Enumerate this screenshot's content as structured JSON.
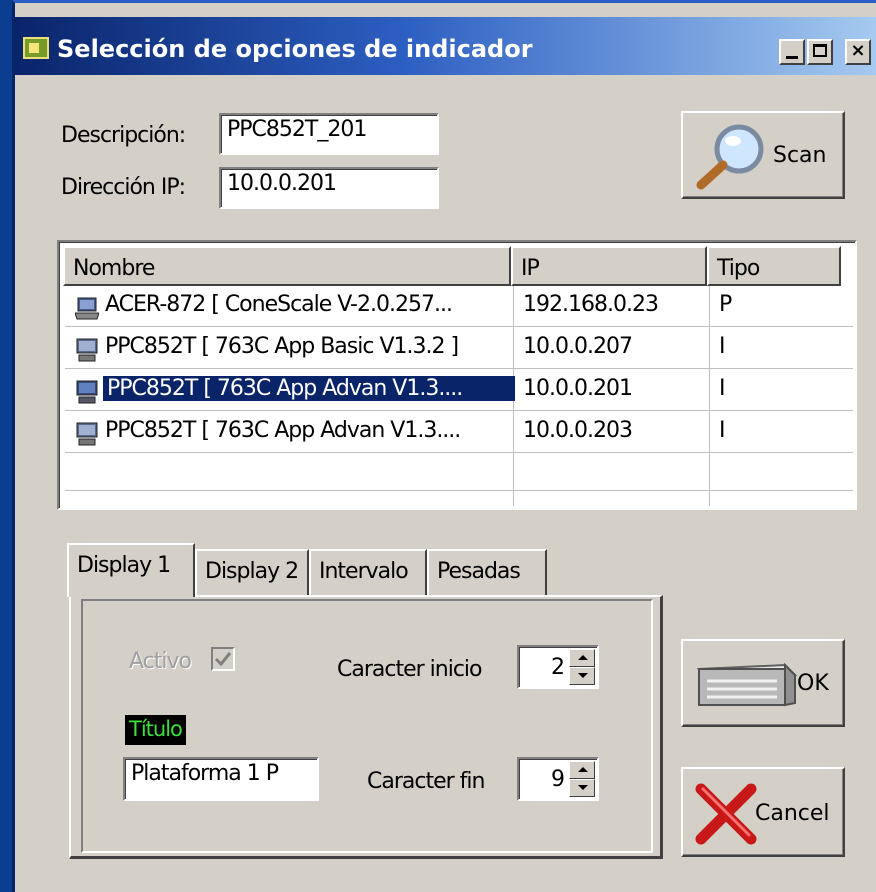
{
  "window": {
    "title": "Selección de opciones de indicador",
    "controls": {
      "minimize": "_",
      "maximize": "□",
      "close": "×"
    }
  },
  "form": {
    "descripcion_label": "Descripción:",
    "descripcion_value": "PPC852T_201",
    "ip_label": "Dirección IP:",
    "ip_value": "10.0.0.201"
  },
  "scan_button": {
    "label": "Scan",
    "icon": "magnifier-icon"
  },
  "device_list": {
    "columns": [
      "Nombre",
      "IP",
      "Tipo"
    ],
    "rows": [
      {
        "icon": "laptop-icon",
        "nombre": "ACER-872  [ ConeScale  V-2.0.257...",
        "ip": "192.168.0.23",
        "tipo": "P",
        "selected": false
      },
      {
        "icon": "computer-icon",
        "nombre": "PPC852T  [ 763C App Basic V1.3.2 ]",
        "ip": "10.0.0.207",
        "tipo": "I",
        "selected": false
      },
      {
        "icon": "computer-icon",
        "nombre": "PPC852T  [ 763C App Advan V1.3....",
        "ip": "10.0.0.201",
        "tipo": "I",
        "selected": true
      },
      {
        "icon": "computer-icon",
        "nombre": "PPC852T  [ 763C App Advan V1.3....",
        "ip": "10.0.0.203",
        "tipo": "I",
        "selected": false
      }
    ]
  },
  "tabs": [
    "Display 1",
    "Display 2",
    "Intervalo",
    "Pesadas"
  ],
  "display1": {
    "activo_label": "Activo",
    "activo_checked": true,
    "titulo_label": "Título",
    "titulo_value": "Plataforma 1    P",
    "caracter_inicio_label": "Caracter inicio",
    "caracter_inicio_value": "2",
    "caracter_fin_label": "Caracter fin",
    "caracter_fin_value": "9"
  },
  "ok_button": {
    "label": "OK",
    "icon": "printer-icon"
  },
  "cancel_button": {
    "label": "Cancel",
    "icon": "red-x-icon"
  },
  "colors": {
    "titlebar_start": "#0a246a",
    "titlebar_end": "#a6caf0",
    "selection": "#0a246a",
    "face": "#d4d0c8"
  }
}
